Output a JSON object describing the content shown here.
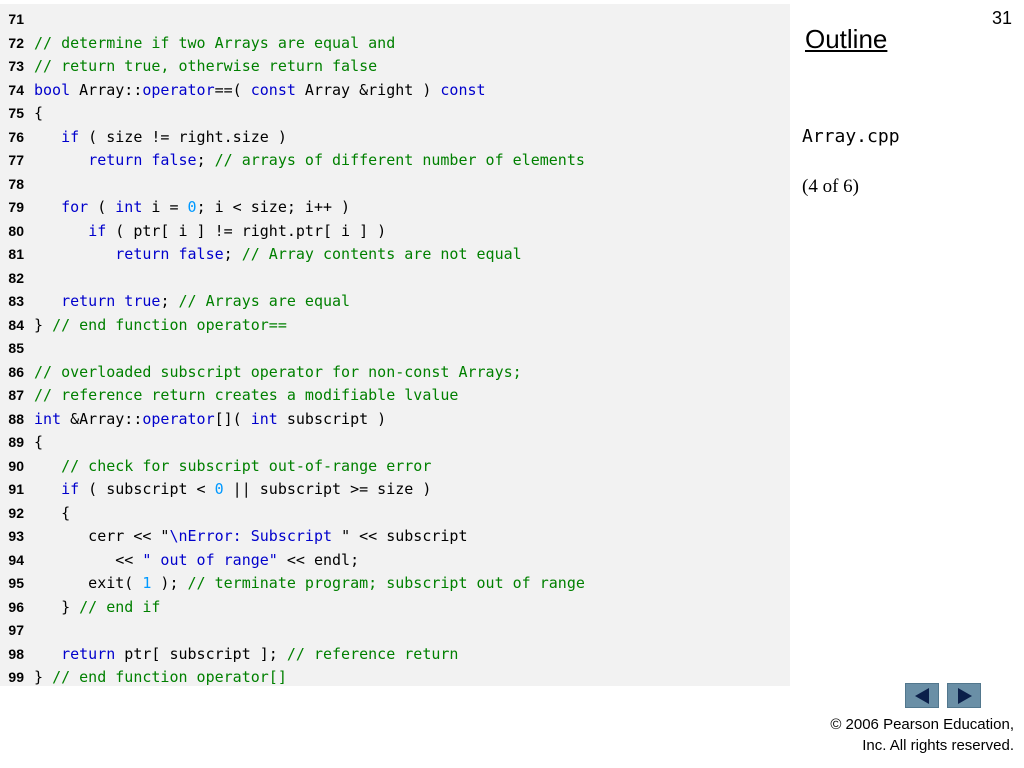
{
  "slide": {
    "page_number": "31",
    "outline_label": "Outline",
    "file_name": "Array.cpp",
    "part_label": "(4 of 6)",
    "copyright_line1": "© 2006 Pearson Education,",
    "copyright_line2": "Inc.  All rights reserved."
  },
  "nav": {
    "prev_icon": "triangle-left-icon",
    "next_icon": "triangle-right-icon"
  },
  "colors": {
    "keyword": "#0000cc",
    "comment": "#008000",
    "number": "#0099ff",
    "panel_bg": "#f2f2f2",
    "nav_button": "#6a8fa6"
  },
  "code": [
    {
      "n": "71",
      "tokens": []
    },
    {
      "n": "72",
      "tokens": [
        {
          "t": "cm",
          "v": "// determine if two Arrays are equal and"
        }
      ]
    },
    {
      "n": "73",
      "tokens": [
        {
          "t": "cm",
          "v": "// return true, otherwise return false"
        }
      ]
    },
    {
      "n": "74",
      "tokens": [
        {
          "t": "kw",
          "v": "bool"
        },
        {
          "t": "p",
          "v": " Array::"
        },
        {
          "t": "kw",
          "v": "operator"
        },
        {
          "t": "p",
          "v": "==( "
        },
        {
          "t": "kw",
          "v": "const"
        },
        {
          "t": "p",
          "v": " Array &right ) "
        },
        {
          "t": "kw",
          "v": "const"
        }
      ]
    },
    {
      "n": "75",
      "tokens": [
        {
          "t": "p",
          "v": "{"
        }
      ]
    },
    {
      "n": "76",
      "tokens": [
        {
          "t": "p",
          "v": "   "
        },
        {
          "t": "kw",
          "v": "if"
        },
        {
          "t": "p",
          "v": " ( size != right.size )"
        }
      ]
    },
    {
      "n": "77",
      "tokens": [
        {
          "t": "p",
          "v": "      "
        },
        {
          "t": "kw",
          "v": "return false"
        },
        {
          "t": "p",
          "v": "; "
        },
        {
          "t": "cm",
          "v": "// arrays of different number of elements"
        }
      ]
    },
    {
      "n": "78",
      "tokens": []
    },
    {
      "n": "79",
      "tokens": [
        {
          "t": "p",
          "v": "   "
        },
        {
          "t": "kw",
          "v": "for"
        },
        {
          "t": "p",
          "v": " ( "
        },
        {
          "t": "kw",
          "v": "int"
        },
        {
          "t": "p",
          "v": " i = "
        },
        {
          "t": "num",
          "v": "0"
        },
        {
          "t": "p",
          "v": "; i < size; i++ )"
        }
      ]
    },
    {
      "n": "80",
      "tokens": [
        {
          "t": "p",
          "v": "      "
        },
        {
          "t": "kw",
          "v": "if"
        },
        {
          "t": "p",
          "v": " ( ptr[ i ] != right.ptr[ i ] )"
        }
      ]
    },
    {
      "n": "81",
      "tokens": [
        {
          "t": "p",
          "v": "         "
        },
        {
          "t": "kw",
          "v": "return false"
        },
        {
          "t": "p",
          "v": "; "
        },
        {
          "t": "cm",
          "v": "// Array contents are not equal"
        }
      ]
    },
    {
      "n": "82",
      "tokens": []
    },
    {
      "n": "83",
      "tokens": [
        {
          "t": "p",
          "v": "   "
        },
        {
          "t": "kw",
          "v": "return true"
        },
        {
          "t": "p",
          "v": "; "
        },
        {
          "t": "cm",
          "v": "// Arrays are equal"
        }
      ]
    },
    {
      "n": "84",
      "tokens": [
        {
          "t": "p",
          "v": "} "
        },
        {
          "t": "cm",
          "v": "// end function operator=="
        }
      ]
    },
    {
      "n": "85",
      "tokens": []
    },
    {
      "n": "86",
      "tokens": [
        {
          "t": "cm",
          "v": "// overloaded subscript operator for non-const Arrays;"
        }
      ]
    },
    {
      "n": "87",
      "tokens": [
        {
          "t": "cm",
          "v": "// reference return creates a modifiable lvalue"
        }
      ]
    },
    {
      "n": "88",
      "tokens": [
        {
          "t": "kw",
          "v": "int"
        },
        {
          "t": "p",
          "v": " &Array::"
        },
        {
          "t": "kw",
          "v": "operator"
        },
        {
          "t": "p",
          "v": "[]( "
        },
        {
          "t": "kw",
          "v": "int"
        },
        {
          "t": "p",
          "v": " subscript )"
        }
      ]
    },
    {
      "n": "89",
      "tokens": [
        {
          "t": "p",
          "v": "{"
        }
      ]
    },
    {
      "n": "90",
      "tokens": [
        {
          "t": "p",
          "v": "   "
        },
        {
          "t": "cm",
          "v": "// check for subscript out-of-range error"
        }
      ]
    },
    {
      "n": "91",
      "tokens": [
        {
          "t": "p",
          "v": "   "
        },
        {
          "t": "kw",
          "v": "if"
        },
        {
          "t": "p",
          "v": " ( subscript < "
        },
        {
          "t": "num",
          "v": "0"
        },
        {
          "t": "p",
          "v": " || subscript >= size )"
        }
      ]
    },
    {
      "n": "92",
      "tokens": [
        {
          "t": "p",
          "v": "   {"
        }
      ]
    },
    {
      "n": "93",
      "tokens": [
        {
          "t": "p",
          "v": "      cerr << \""
        },
        {
          "t": "str",
          "v": "\\nError: Subscript "
        },
        {
          "t": "p",
          "v": "\" << subscript"
        }
      ]
    },
    {
      "n": "94",
      "tokens": [
        {
          "t": "p",
          "v": "         << "
        },
        {
          "t": "str",
          "v": "\" out of range\""
        },
        {
          "t": "p",
          "v": " << endl;"
        }
      ]
    },
    {
      "n": "95",
      "tokens": [
        {
          "t": "p",
          "v": "      exit( "
        },
        {
          "t": "num",
          "v": "1"
        },
        {
          "t": "p",
          "v": " ); "
        },
        {
          "t": "cm",
          "v": "// terminate program; subscript out of range"
        }
      ]
    },
    {
      "n": "96",
      "tokens": [
        {
          "t": "p",
          "v": "   } "
        },
        {
          "t": "cm",
          "v": "// end if"
        }
      ]
    },
    {
      "n": "97",
      "tokens": []
    },
    {
      "n": "98",
      "tokens": [
        {
          "t": "p",
          "v": "   "
        },
        {
          "t": "kw",
          "v": "return"
        },
        {
          "t": "p",
          "v": " ptr[ subscript ]; "
        },
        {
          "t": "cm",
          "v": "// reference return"
        }
      ]
    },
    {
      "n": "99",
      "tokens": [
        {
          "t": "p",
          "v": "} "
        },
        {
          "t": "cm",
          "v": "// end function operator[]"
        }
      ]
    }
  ]
}
